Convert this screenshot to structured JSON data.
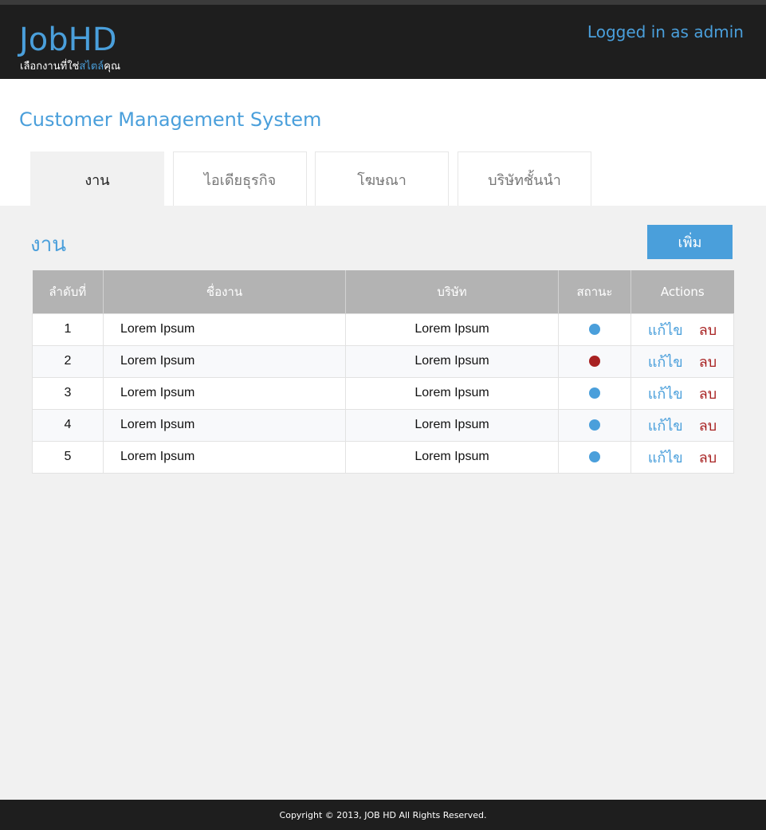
{
  "header": {
    "logo": "JobHD",
    "tagline_pre": "เลือกงานที่ใช่",
    "tagline_highlight": "สไตล์",
    "tagline_post": "คุณ",
    "login_text": "Logged in as admin"
  },
  "page_title": "Customer Management System",
  "tabs": [
    {
      "label": "งาน",
      "active": true
    },
    {
      "label": "ไอเดียธุรกิจ",
      "active": false
    },
    {
      "label": "โฆษณา",
      "active": false
    },
    {
      "label": "บริษัทชั้นนำ",
      "active": false
    }
  ],
  "section_title": "งาน",
  "add_button": "เพิ่ม",
  "table": {
    "columns": [
      "ลำดับที่",
      "ชื่องาน",
      "บริษัท",
      "สถานะ",
      "Actions"
    ],
    "rows": [
      {
        "no": "1",
        "name": "Lorem Ipsum",
        "company": "Lorem Ipsum",
        "status_color": "#4a9fdb"
      },
      {
        "no": "2",
        "name": "Lorem Ipsum",
        "company": "Lorem Ipsum",
        "status_color": "#a82222"
      },
      {
        "no": "3",
        "name": "Lorem Ipsum",
        "company": "Lorem Ipsum",
        "status_color": "#4a9fdb"
      },
      {
        "no": "4",
        "name": "Lorem Ipsum",
        "company": "Lorem Ipsum",
        "status_color": "#4a9fdb"
      },
      {
        "no": "5",
        "name": "Lorem Ipsum",
        "company": "Lorem Ipsum",
        "status_color": "#4a9fdb"
      }
    ],
    "edit_label": "แก้ไข",
    "delete_label": "ลบ"
  },
  "footer": "Copyright © 2013, JOB HD All Rights Reserved.",
  "colors": {
    "accent": "#4a9fdb",
    "danger": "#a82222",
    "header_bg": "#1e1e1e",
    "content_bg": "#f1f1f1"
  }
}
